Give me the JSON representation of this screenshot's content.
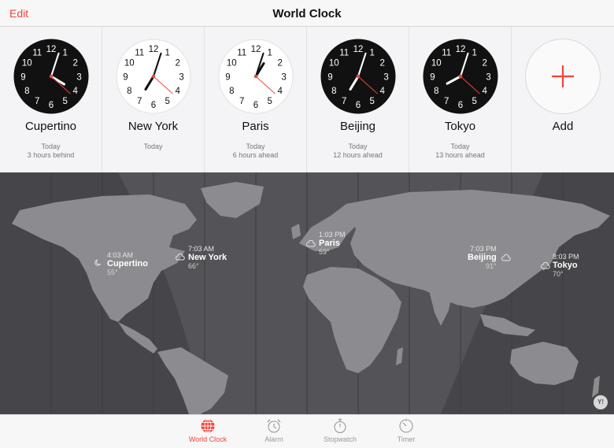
{
  "header": {
    "title": "World Clock",
    "edit_label": "Edit"
  },
  "clocks": [
    {
      "city": "Cupertino",
      "day": "Today",
      "diff": "3 hours behind",
      "theme": "dark",
      "time": "4:03"
    },
    {
      "city": "New York",
      "day": "Today",
      "diff": "",
      "theme": "light",
      "time": "7:03"
    },
    {
      "city": "Paris",
      "day": "Today",
      "diff": "6 hours ahead",
      "theme": "light",
      "time": "1:03"
    },
    {
      "city": "Beijing",
      "day": "Today",
      "diff": "12 hours ahead",
      "theme": "dark",
      "time": "7:03"
    },
    {
      "city": "Tokyo",
      "day": "Today",
      "diff": "13 hours ahead",
      "theme": "dark",
      "time": "8:03"
    }
  ],
  "clock_numbers": [
    "12",
    "1",
    "2",
    "3",
    "4",
    "5",
    "6",
    "7",
    "8",
    "9",
    "10",
    "11"
  ],
  "add_label": "Add",
  "map": {
    "locations": [
      {
        "city": "Cupertino",
        "time": "4:03 AM",
        "temp": "55°",
        "weather": "moon-icon"
      },
      {
        "city": "New York",
        "time": "7:03 AM",
        "temp": "66°",
        "weather": "cloud-icon"
      },
      {
        "city": "Paris",
        "time": "1:03 PM",
        "temp": "59°",
        "weather": "cloud-icon"
      },
      {
        "city": "Beijing",
        "time": "7:03 PM",
        "temp": "91°",
        "weather": "cloud-icon"
      },
      {
        "city": "Tokyo",
        "time": "8:03 PM",
        "temp": "70°",
        "weather": "cloud-icon"
      }
    ],
    "attribution": "Y!"
  },
  "tabs": [
    {
      "label": "World Clock",
      "icon": "globe-icon",
      "active": true
    },
    {
      "label": "Alarm",
      "icon": "alarm-icon",
      "active": false
    },
    {
      "label": "Stopwatch",
      "icon": "stopwatch-icon",
      "active": false
    },
    {
      "label": "Timer",
      "icon": "timer-icon",
      "active": false
    }
  ],
  "colors": {
    "accent": "#f0453a",
    "map_bg": "#4a4a4e",
    "land": "#8c8c90",
    "clock_dark": "#111111",
    "clock_light": "#ffffff"
  }
}
